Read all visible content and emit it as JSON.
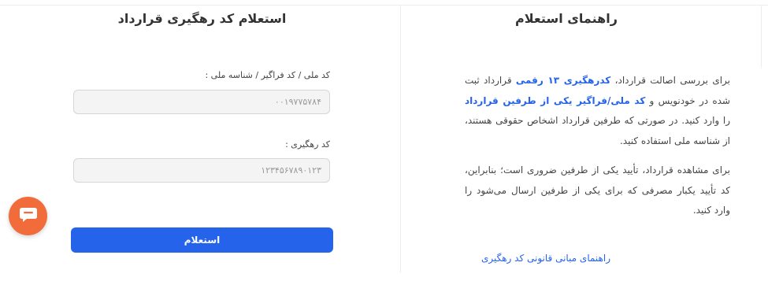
{
  "guide": {
    "title": "راهنمای استعلام",
    "p1": {
      "t1": "برای بررسی اصالت قرارداد، ",
      "h1": "کدرهگیری ۱۳ رقمی",
      "t2": " قرارداد ثبت شده در خودنویس و ",
      "h2": "کد ملی/فراگیر یکی از طرفین قرارداد",
      "t3": " را وارد کنید. در صورتی که طرفین قرارداد اشخاص حقوقی هستند، از شناسه ملی استفاده کنید."
    },
    "p2": "برای مشاهده قرارداد، تأیید یکی از طرفین ضروری است؛ بنابراین، کد تأیید یکبار مصرفی که برای یکی از طرفین ارسال می‌شود را وارد کنید.",
    "link": "راهنمای مبانی قانونی کد رهگیری"
  },
  "form": {
    "title": "استعلام کد رهگیری قرارداد",
    "national_id": {
      "label": "کد ملی / کد فراگیر / شناسه ملی :",
      "placeholder": "۰۰۱۹۷۷۵۷۸۴"
    },
    "tracking_code": {
      "label": "کد رهگیری :",
      "placeholder": "۱۲۳۴۵۶۷۸۹۰۱۲۳"
    },
    "submit_label": "استعلام"
  },
  "chat": {
    "icon": "chat-bubble-icon",
    "color": "#f26b3a"
  },
  "colors": {
    "accent": "#2563eb"
  }
}
